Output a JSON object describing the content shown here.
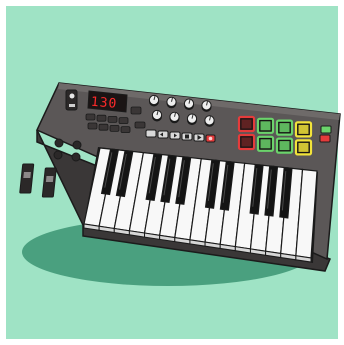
{
  "illustration": {
    "subject": "midi-keyboard-controller",
    "display_value": "130",
    "colors": {
      "frame": "#ffffff",
      "background": "#9fe3c5",
      "shadow": "#4aa07f",
      "body": "#5b5757",
      "body_top_edge": "#6e6a69",
      "body_side": "#3a3737",
      "outline": "#1b1b1b",
      "display_bg": "#1a1414",
      "display_text": "#ff2a2a",
      "knob": "#eeeeee",
      "pad_red": "#e53b3b",
      "pad_green": "#6bd36b",
      "pad_yellow": "#f2e33a",
      "white_key": "#f8f8f8",
      "black_key": "#141414"
    },
    "pads": {
      "rows": [
        [
          "pad_red",
          "pad_green",
          "pad_green",
          "pad_yellow"
        ],
        [
          "pad_red",
          "pad_green",
          "pad_green",
          "pad_yellow"
        ]
      ]
    },
    "knob_count": 8,
    "white_key_count": 15,
    "black_key_count": 10,
    "icons": [
      "rewind-icon",
      "fast-forward-icon",
      "stop-icon",
      "play-icon",
      "record-icon"
    ]
  }
}
